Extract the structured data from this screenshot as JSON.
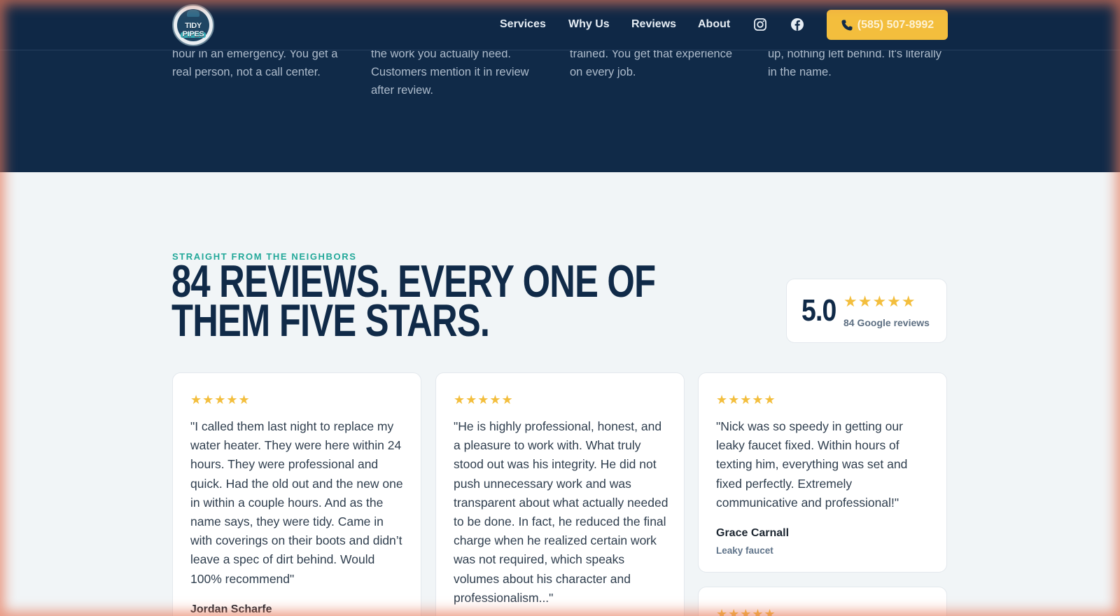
{
  "header": {
    "logo_text": "TIDY PIPES",
    "nav": [
      "Services",
      "Why Us",
      "Reviews",
      "About"
    ],
    "social": [
      "instagram-icon",
      "facebook-icon"
    ],
    "phone_label": "(585) 507-8992",
    "accent": "#f3be3d",
    "bg": "#0f2846"
  },
  "features": [
    {
      "text": "hour in an emergency. You get a real person, not a call center."
    },
    {
      "text": "the work you actually need. Customers mention it in review after review."
    },
    {
      "text": "trained. You get that experience on every job."
    },
    {
      "text": "up, nothing left behind. It's literally in the name."
    }
  ],
  "reviews_section": {
    "eyebrow": "STRAIGHT FROM THE NEIGHBORS",
    "headline_line1": "84 REVIEWS. EVERY ONE OF",
    "headline_line2": "THEM FIVE STARS.",
    "rating": {
      "score": "5.0",
      "stars": "★★★★★",
      "label": "84 Google reviews"
    },
    "reviews": [
      {
        "stars": "★★★★★",
        "text": "\"I called them last night to replace my water heater. They were here within 24 hours. They were professional and quick. Had the old out and the new one in within a couple hours. And as the name says, they were tidy. Came in with coverings on their boots and didn’t leave a spec of dirt behind. Would 100% recommend\"",
        "author": "Jordan Scharfe",
        "topic": ""
      },
      {
        "stars": "★★★★★",
        "text": "\"He is highly professional, honest, and a pleasure to work with. What truly stood out was his integrity. He did not push unnecessary work and was transparent about what actually needed to be done. In fact, he reduced the final charge when he realized certain work was not required, which speaks volumes about his character and professionalism...\"",
        "author": "",
        "topic": ""
      },
      {
        "stars": "★★★★★",
        "text": "\"Nick was so speedy in getting our leaky faucet fixed. Within hours of texting him, everything was set and fixed perfectly. Extremely communicative and professional!\"",
        "author": "Grace Carnall",
        "topic": "Leaky faucet"
      },
      {
        "stars": "★★★★★",
        "text": "",
        "author": "",
        "topic": ""
      }
    ]
  }
}
